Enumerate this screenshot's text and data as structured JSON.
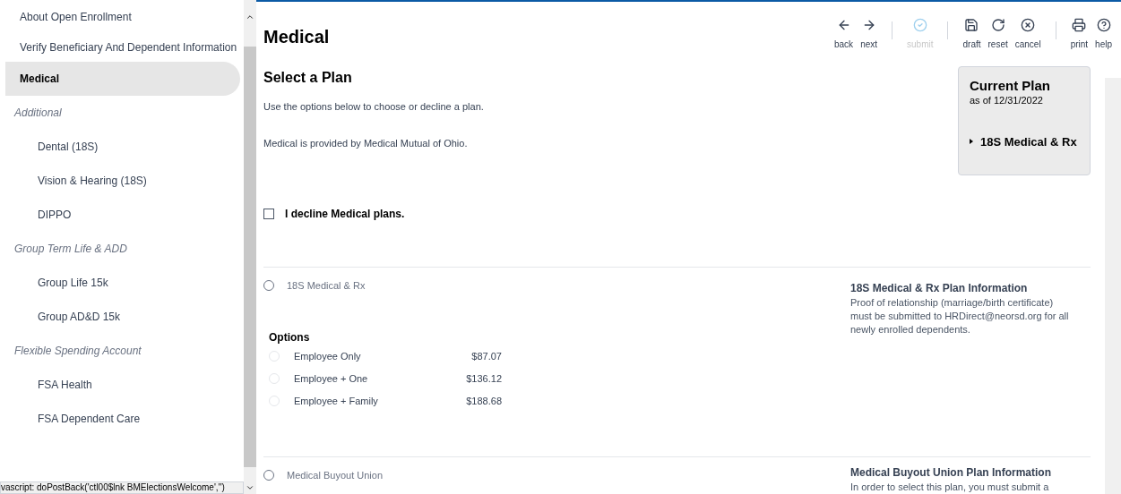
{
  "sidebar": {
    "items": [
      {
        "label": "About Open Enrollment",
        "kind": "item",
        "selected": false
      },
      {
        "label": "Verify Beneficiary And Dependent Information",
        "kind": "item",
        "selected": false
      },
      {
        "label": "Medical",
        "kind": "item",
        "selected": true
      },
      {
        "label": "Additional",
        "kind": "heading"
      },
      {
        "label": "Dental (18S)",
        "kind": "sub",
        "selected": false
      },
      {
        "label": "Vision & Hearing (18S)",
        "kind": "sub",
        "selected": false
      },
      {
        "label": "DIPPO",
        "kind": "sub",
        "selected": false
      },
      {
        "label": "Group Term Life & ADD",
        "kind": "heading"
      },
      {
        "label": "Group Life 15k",
        "kind": "sub",
        "selected": false
      },
      {
        "label": "Group AD&D 15k",
        "kind": "sub",
        "selected": false
      },
      {
        "label": "Flexible Spending Account",
        "kind": "heading"
      },
      {
        "label": "FSA Health",
        "kind": "sub",
        "selected": false
      },
      {
        "label": "FSA Dependent Care",
        "kind": "sub",
        "selected": false
      }
    ]
  },
  "status_bar": "vascript:  doPostBack('ctl00$lnk BMElectionsWelcome','')",
  "page_title": "Medical",
  "toolbar": [
    {
      "kind": "back",
      "label": "back",
      "disabled": false
    },
    {
      "kind": "next",
      "label": "next",
      "disabled": false
    },
    {
      "kind": "separator"
    },
    {
      "kind": "submit",
      "label": "submit",
      "disabled": true
    },
    {
      "kind": "separator"
    },
    {
      "kind": "draft",
      "label": "draft",
      "disabled": false
    },
    {
      "kind": "reset",
      "label": "reset",
      "disabled": false
    },
    {
      "kind": "cancel",
      "label": "cancel",
      "disabled": false
    },
    {
      "kind": "separator"
    },
    {
      "kind": "print",
      "label": "print",
      "disabled": false
    },
    {
      "kind": "help",
      "label": "help",
      "disabled": false
    }
  ],
  "section_title": "Select a Plan",
  "intro": [
    "Use the options below to choose or decline a plan.",
    "Medical is provided by Medical Mutual of Ohio."
  ],
  "decline": {
    "label": "I decline Medical plans.",
    "checked": false
  },
  "current_plan": {
    "title": "Current Plan",
    "date": "as of 12/31/2022",
    "plan": "18S Medical & Rx"
  },
  "plans": [
    {
      "name": "18S Medical & Rx",
      "selected": false,
      "options_title": "Options",
      "options": [
        {
          "label": "Employee Only",
          "price": "$87.07",
          "selected": false
        },
        {
          "label": "Employee + One",
          "price": "$136.12",
          "selected": false
        },
        {
          "label": "Employee + Family",
          "price": "$188.68",
          "selected": false
        }
      ],
      "info_title": "18S Medical & Rx Plan Information",
      "info_text": "Proof of relationship (marriage/birth certificate) must be submitted to HRDirect@neorsd.org for all newly enrolled dependents."
    },
    {
      "name": "Medical Buyout Union",
      "selected": false,
      "info_title": "Medical Buyout Union Plan Information",
      "info_text": "In order to select this plan, you must submit a"
    }
  ]
}
